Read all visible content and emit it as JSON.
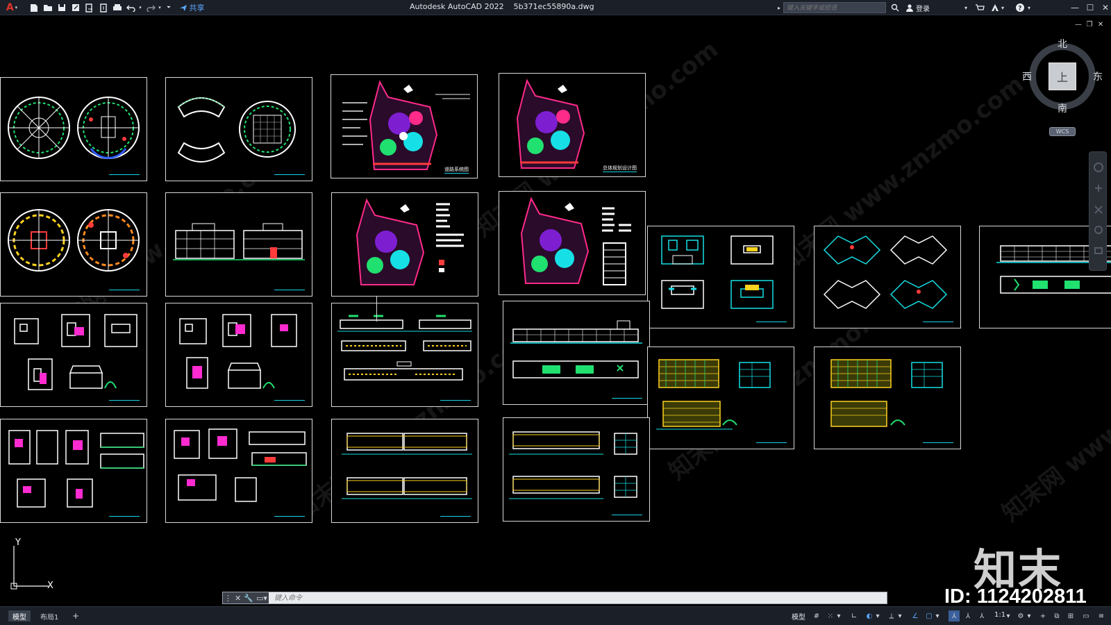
{
  "titlebar": {
    "app_logo": "A",
    "share_label": "共享",
    "title": "Autodesk AutoCAD 2022    5b371ec55890a.dwg",
    "search_placeholder": "键入关键字或短语",
    "login_label": "登录"
  },
  "viewcube": {
    "north": "北",
    "south": "南",
    "east": "东",
    "west": "西",
    "face": "上",
    "wcs": "WCS"
  },
  "sheets": [
    {
      "label": "",
      "kind": "round-plans"
    },
    {
      "label": "",
      "kind": "curved-plans"
    },
    {
      "label": "道路系统图",
      "kind": "site-plan"
    },
    {
      "label": "总体规划设计图",
      "kind": "site-plan"
    },
    {
      "label": "",
      "kind": "round-plans"
    },
    {
      "label": "",
      "kind": "elevations"
    },
    {
      "label": "",
      "kind": "site-plan-notes"
    },
    {
      "label": "",
      "kind": "site-plan-notes"
    },
    {
      "label": "",
      "kind": "unit-plans"
    },
    {
      "label": "",
      "kind": "unit-plans"
    },
    {
      "label": "",
      "kind": "long-building"
    },
    {
      "label": "",
      "kind": "villa-plans"
    },
    {
      "label": "",
      "kind": "villa-plans"
    },
    {
      "label": "",
      "kind": "long-section"
    },
    {
      "label": "",
      "kind": "long-section"
    },
    {
      "label": "",
      "kind": "apartment-elev"
    },
    {
      "label": "",
      "kind": "apartment-elev"
    },
    {
      "label": "",
      "kind": "villa-plans"
    },
    {
      "label": "",
      "kind": "villa-plans"
    },
    {
      "label": "",
      "kind": "long-plan"
    },
    {
      "label": "",
      "kind": "long-plan"
    }
  ],
  "ucs": {
    "y": "Y",
    "x": "X"
  },
  "command": {
    "placeholder": "键入命令"
  },
  "status": {
    "tab_model": "模型",
    "tab_layout1": "布局1",
    "tab_add": "+",
    "model_label": "模型",
    "scale": "1:1"
  },
  "watermark": {
    "text": "知末网 www.znzmo.com"
  },
  "brand": {
    "logo": "知末",
    "id": "ID: 1124202811"
  }
}
